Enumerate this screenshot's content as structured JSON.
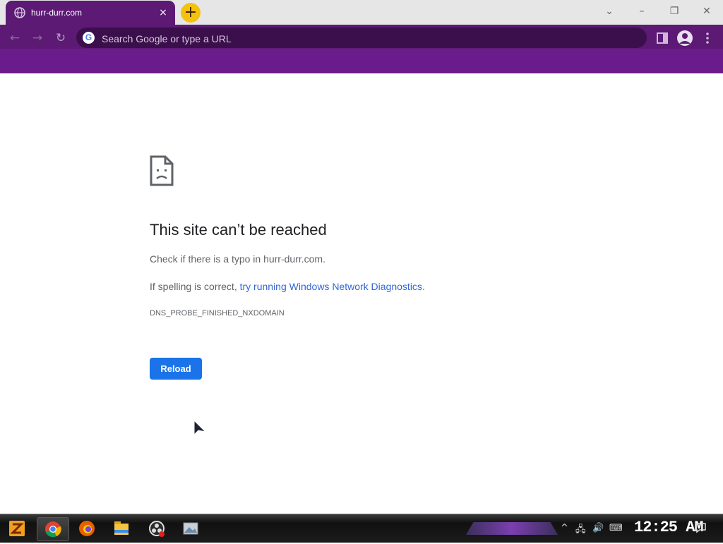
{
  "browser": {
    "tab": {
      "title": "hurr-durr.com",
      "close_symbol": "×"
    },
    "new_tab_symbol": "+",
    "omnibox": {
      "placeholder": "Search Google or type a URL",
      "value": ""
    },
    "colors": {
      "frame": "#5c1a74",
      "toolbar": "#6a1b8c",
      "omnibox": "#3b0f4b",
      "new_tab": "#f4c20d"
    }
  },
  "error_page": {
    "title": "This site can’t be reached",
    "line1": "Check if there is a typo in hurr-durr.com.",
    "line2_prefix": "If spelling is correct, ",
    "line2_link": "try running Windows Network Diagnostics",
    "line2_suffix": ".",
    "error_code": "DNS_PROBE_FINISHED_NXDOMAIN",
    "reload_label": "Reload",
    "colors": {
      "button": "#1a73e8",
      "link": "#3367d6"
    }
  },
  "taskbar": {
    "apps": [
      "start-icon",
      "chrome-icon",
      "firefox-icon",
      "file-explorer-icon",
      "obs-icon",
      "image-app-icon"
    ],
    "clock": "12:25 AM"
  }
}
